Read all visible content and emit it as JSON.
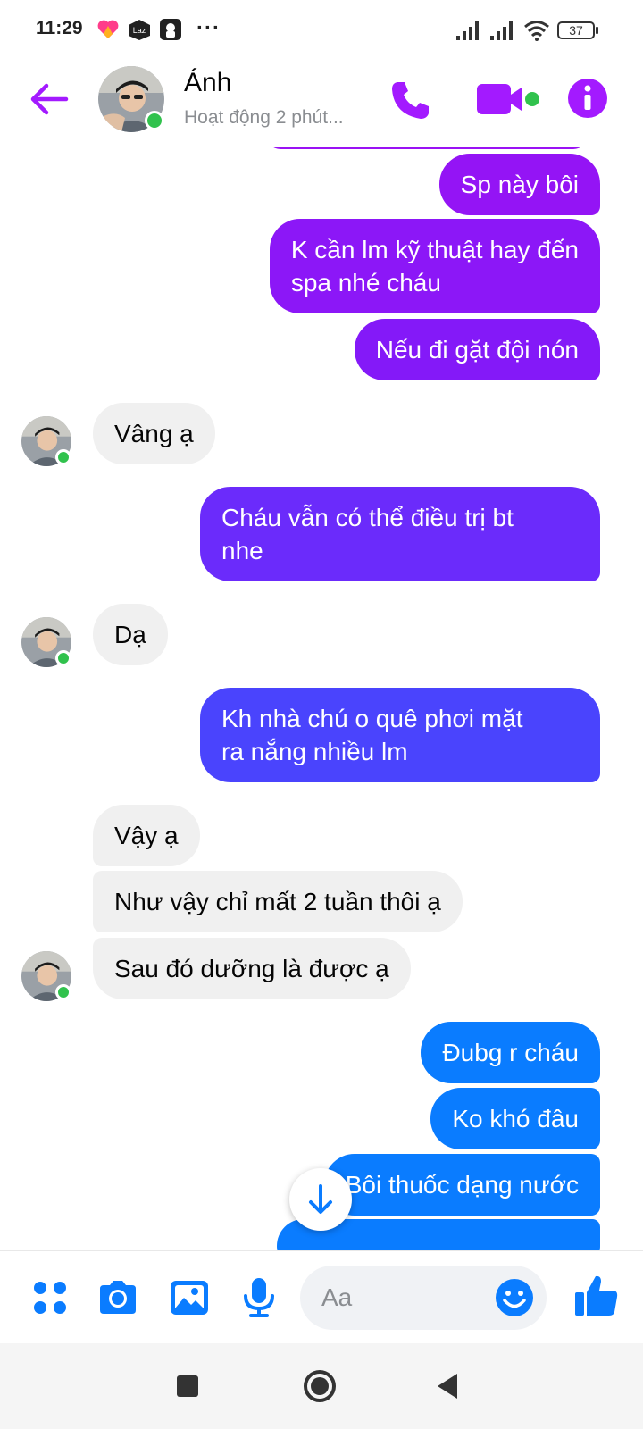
{
  "status_bar": {
    "time": "11:29",
    "more": "···",
    "battery": "37",
    "icons": [
      "heart-app-icon",
      "lazada-icon",
      "app-icon",
      "signal-icon",
      "signal-icon",
      "wifi-icon",
      "battery-icon"
    ]
  },
  "header": {
    "contact_name": "Ánh",
    "status_text": "Hoạt động 2 phút...",
    "accent_color": "#a31aff",
    "online_color": "#31c24d"
  },
  "messages": [
    {
      "from": "me",
      "text": "Sp này bôi",
      "color": "#9414f5"
    },
    {
      "from": "me",
      "text": "K cần lm kỹ thuật hay đến\nspa nhé cháu",
      "color": "#8c17f7"
    },
    {
      "from": "me",
      "text": "Nếu đi gặt đội nón",
      "color": "#8419f8"
    },
    {
      "from": "them",
      "text": "Vâng ạ"
    },
    {
      "from": "me",
      "text": "Cháu vẫn có thể điều trị bt\nnhe",
      "color": "#6b2bfb"
    },
    {
      "from": "them",
      "text": "Dạ"
    },
    {
      "from": "me",
      "text": "Kh nhà chú o quê phơi mặt\nra nắng nhiều lm",
      "color": "#4a44fd"
    },
    {
      "from": "them",
      "text": "Vậy ạ"
    },
    {
      "from": "them",
      "text": "Như vậy chỉ mất 2 tuần thôi ạ"
    },
    {
      "from": "them",
      "text": "Sau đó dưỡng là được ạ"
    },
    {
      "from": "me",
      "text": "Đubg r cháu",
      "color": "#0a7cff"
    },
    {
      "from": "me",
      "text": "Ko khó đâu",
      "color": "#0a7cff"
    },
    {
      "from": "me",
      "text": "Bôi thuốc dạng nước",
      "color": "#0a7cff"
    }
  ],
  "composer": {
    "placeholder": "Aa",
    "icon_color": "#0a7cff"
  },
  "navbar": {
    "icons": [
      "recent-apps-icon",
      "home-icon",
      "back-icon"
    ]
  }
}
